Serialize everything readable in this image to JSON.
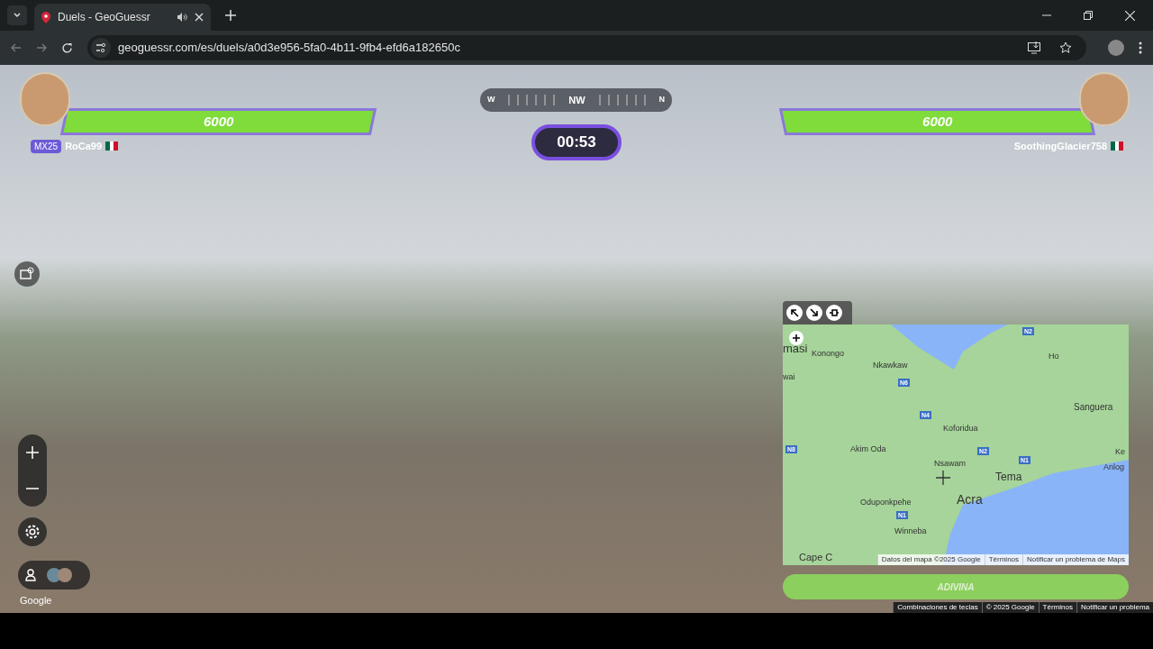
{
  "browser": {
    "tab": {
      "title": "Duels - GeoGuessr",
      "audio": true
    },
    "url": "geoguessr.com/es/duels/a0d3e956-5fa0-4b11-9fb4-efd6a182650c"
  },
  "players": [
    {
      "name": "RoCa99",
      "badge": "MX25",
      "score": "6000",
      "level": 1
    },
    {
      "name": "SoothingGlacier758",
      "score": "6000",
      "level": 1
    }
  ],
  "compass": [
    "W",
    "NW",
    "N"
  ],
  "timer": "00:53",
  "map": {
    "places": [
      "masi",
      "Konongo",
      "Nkawkaw",
      "wai",
      "Ho",
      "Sanguera",
      "Koforidua",
      "Akim Oda",
      "Nsawam",
      "Tema",
      "Oduponkpehe",
      "Acra",
      "Winneba",
      "Ke",
      "Anlog",
      "Cape C"
    ],
    "roads": [
      "N2",
      "N6",
      "N4",
      "N8",
      "N2",
      "N1",
      "N1"
    ],
    "attribution": [
      "Datos del mapa ©2025 Google",
      "Términos",
      "Notificar un problema de Maps"
    ]
  },
  "guess_button": "ADIVINA",
  "google_label": "Google",
  "footer_links": [
    "Combinaciones de teclas",
    "© 2025 Google",
    "Términos",
    "Notificar un problema"
  ]
}
